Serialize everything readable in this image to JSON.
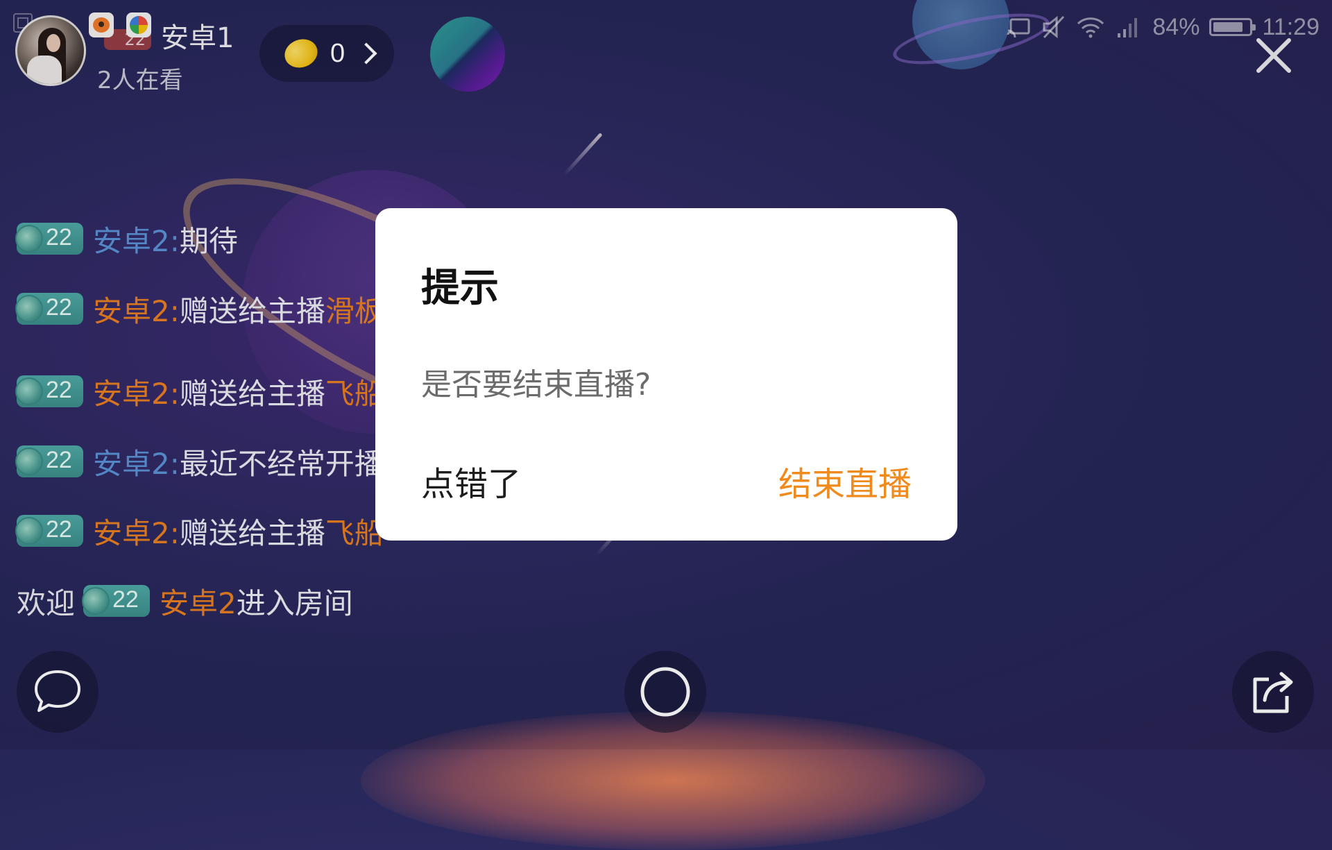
{
  "status_bar": {
    "battery_percent": "84%",
    "battery_level": 0.84,
    "time": "11:29",
    "icons": [
      "cast-icon",
      "mute-icon",
      "wifi-icon",
      "signal-icon",
      "battery-icon"
    ]
  },
  "header": {
    "anchor_name": "安卓1",
    "level_badge": "22",
    "viewer_count": "2人在看",
    "coin_count": "0"
  },
  "chat": {
    "messages": [
      {
        "level": "22",
        "user": "安卓2:",
        "text": "期待",
        "gift": "",
        "name_color": "blue"
      },
      {
        "level": "22",
        "user": "安卓2:",
        "text": "赠送给主播",
        "gift": "滑板",
        "name_color": "orange"
      },
      {
        "level": "22",
        "user": "安卓2:",
        "text": "赠送给主播",
        "gift": "飞船",
        "name_color": "orange"
      },
      {
        "level": "22",
        "user": "安卓2:",
        "text": "最近不经常开播",
        "gift": "",
        "name_color": "blue"
      },
      {
        "level": "22",
        "user": "安卓2:",
        "text": "赠送给主播",
        "gift": "飞船",
        "name_color": "orange"
      }
    ],
    "welcome": {
      "prefix": "欢迎",
      "level": "22",
      "user": "安卓2",
      "suffix": "进入房间"
    }
  },
  "dialog": {
    "title": "提示",
    "message": "是否要结束直播?",
    "cancel_label": "点错了",
    "confirm_label": "结束直播"
  },
  "colors": {
    "accent_orange": "#f08a1c",
    "name_blue": "#5b92d6",
    "name_orange": "#ea7f22",
    "badge_teal": "#4fa9a6"
  }
}
